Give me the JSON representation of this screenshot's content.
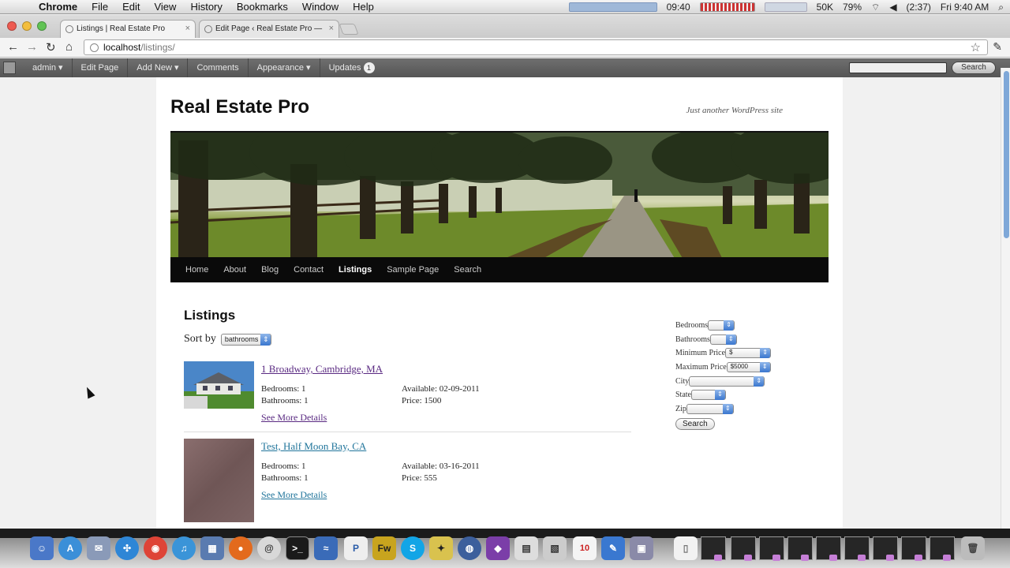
{
  "menubar": {
    "app": "Chrome",
    "menus": [
      "File",
      "Edit",
      "View",
      "History",
      "Bookmarks",
      "Window",
      "Help"
    ],
    "status": {
      "time_small": "09:40",
      "battery_small": "50K",
      "wifi_pct": "79%",
      "battery_time": "(2:37)",
      "clock": "Fri 9:40 AM"
    }
  },
  "tabs": [
    {
      "title": "Listings | Real Estate Pro"
    },
    {
      "title": "Edit Page ‹ Real Estate Pro — "
    }
  ],
  "address": {
    "host": "localhost",
    "path": "/listings/"
  },
  "adminbar": {
    "items": [
      "admin ▾",
      "Edit Page",
      "Add New ▾",
      "Comments",
      "Appearance ▾",
      "Updates"
    ],
    "updates_count": "1",
    "search_button": "Search"
  },
  "site": {
    "title": "Real Estate Pro",
    "tagline": "Just another WordPress site",
    "nav": [
      "Home",
      "About",
      "Blog",
      "Contact",
      "Listings",
      "Sample Page",
      "Search"
    ],
    "nav_current": "Listings"
  },
  "content": {
    "heading": "Listings",
    "sort_label": "Sort by",
    "sort_value": "bathrooms",
    "listings": [
      {
        "title": "1 Broadway, Cambridge, MA",
        "bedrooms": "Bedrooms: 1",
        "bathrooms": "Bathrooms: 1",
        "available": "Available: 02-09-2011",
        "price": "Price: 1500",
        "details": "See More Details"
      },
      {
        "title": "Test, Half Moon Bay, CA",
        "bedrooms": "Bedrooms: 1",
        "bathrooms": "Bathrooms: 1",
        "available": "Available: 03-16-2011",
        "price": "Price: 555",
        "details": "See More Details"
      }
    ]
  },
  "search_form": {
    "bedrooms_label": "Bedrooms",
    "bathrooms_label": "Bathrooms",
    "min_price_label": "Minimum Price",
    "min_price_value": "$",
    "max_price_label": "Maximum Price",
    "max_price_value": "$5000",
    "city_label": "City",
    "state_label": "State",
    "zip_label": "Zip",
    "button": "Search"
  },
  "colors": {
    "link": "#21759b",
    "visited": "#5a2a82",
    "admin_bar": "#555555",
    "nav_bar": "#0a0a0a"
  }
}
